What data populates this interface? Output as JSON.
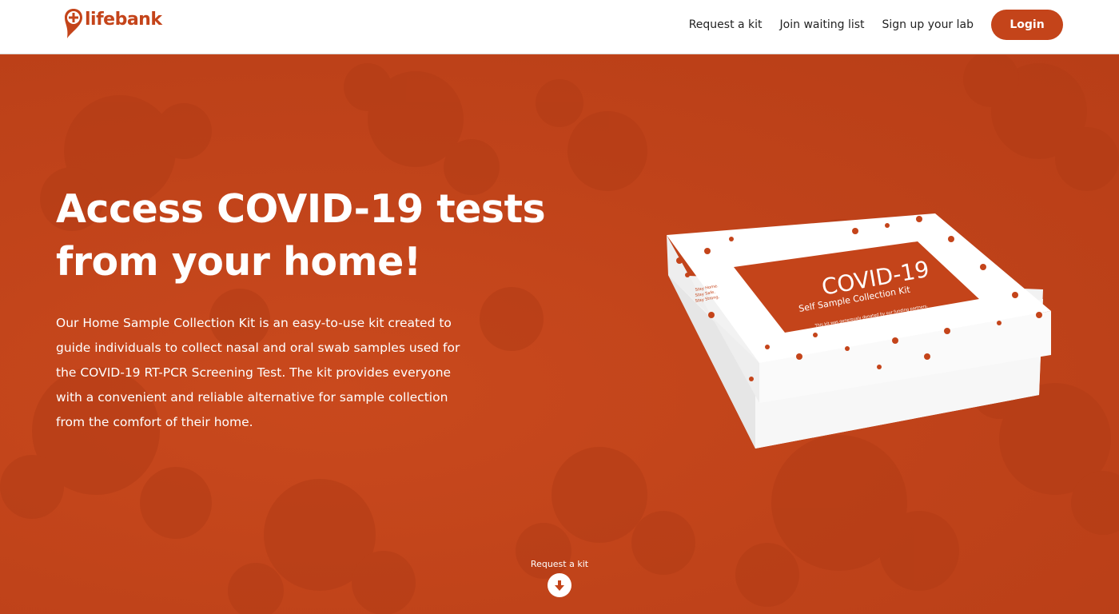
{
  "brand": {
    "name": "lifebank",
    "color": "#c4441a",
    "icon": "location-pin-plus-icon"
  },
  "nav": {
    "links": [
      "Request a kit",
      "Join waiting list",
      "Sign up your lab"
    ],
    "login_label": "Login"
  },
  "hero": {
    "title_line1": "Access COVID-19 tests",
    "title_line2": "from your home!",
    "description": "Our Home Sample Collection Kit is an easy-to-use kit created to guide individuals to collect nasal and oral swab samples used for the COVID-19 RT-PCR Screening Test. The kit provides everyone with a convenient and reliable alternative for sample collection from the comfort of their home.",
    "background_color": "#c4441a"
  },
  "kit": {
    "title": "COVID-19",
    "subtitle": "Self Sample Collection Kit",
    "note": "This kit was generously donated by our funding partners.",
    "slogan": [
      "Stay Home.",
      "Stay Safe.",
      "Stay Strong."
    ]
  },
  "scroll_cta": {
    "label": "Request a kit",
    "icon": "arrow-down-circle-icon"
  }
}
